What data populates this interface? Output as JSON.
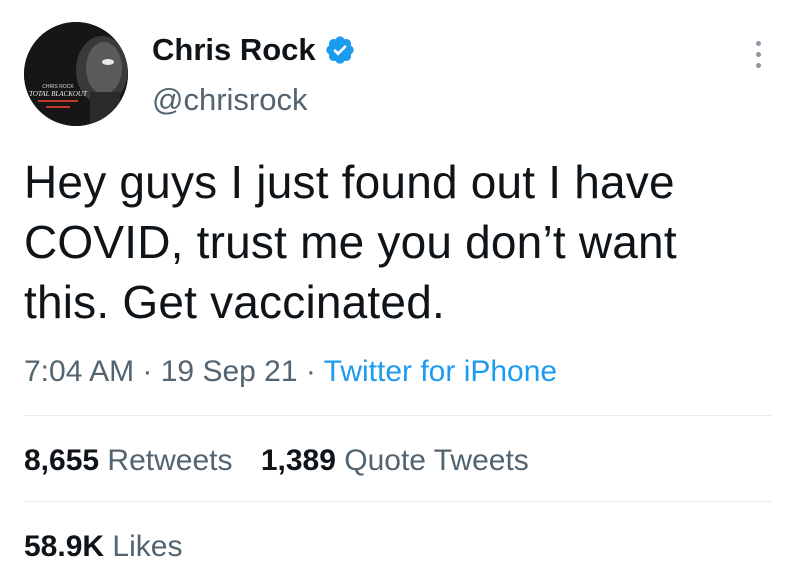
{
  "author": {
    "name": "Chris Rock",
    "handle": "@chrisrock",
    "verified": true,
    "avatar_icon": "avatar-chris-rock-total-blackout",
    "avatar_text": [
      "CHRIS ROCK",
      "TOTAL BLACKOUT"
    ]
  },
  "tweet": {
    "text_lines": [
      "Hey guys I just found out I have",
      "COVID, trust me you don’t want",
      "this. Get vaccinated."
    ],
    "time": "7:04 AM",
    "date": "19 Sep 21",
    "separator": " · ",
    "source": "Twitter for iPhone"
  },
  "stats": {
    "retweets_count": "8,655",
    "retweets_label": "Retweets",
    "quotes_count": "1,389",
    "quotes_label": "Quote Tweets",
    "likes_count": "58.9K",
    "likes_label": "Likes"
  },
  "colors": {
    "text": "#0f1419",
    "secondary": "#536471",
    "accent": "#1d9bf0",
    "divider": "#e6ecf0"
  },
  "icons": {
    "verified": "verified-badge-icon",
    "more": "more-options-icon"
  }
}
